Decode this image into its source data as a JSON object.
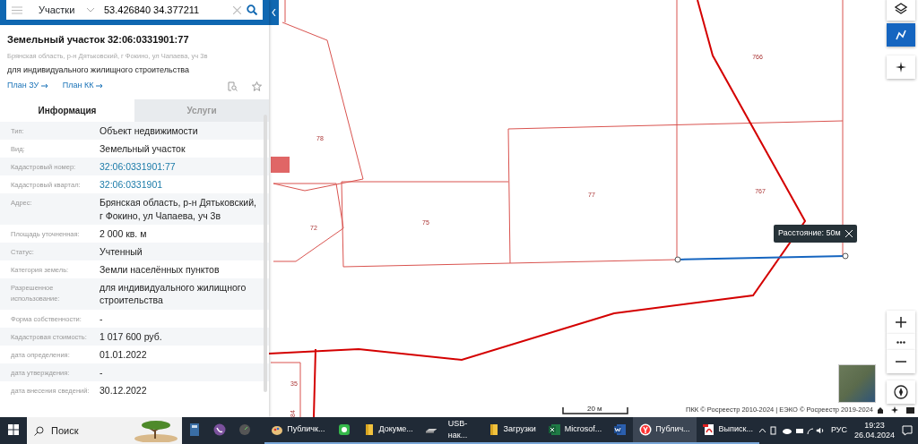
{
  "search": {
    "category": "Участки",
    "query": "53.426840 34.377211"
  },
  "parcel": {
    "title": "Земельный участок 32:06:0331901:77",
    "address": "Брянская область, р-н Дятьковский, г Фокино, ул Чапаева, уч 3в",
    "purpose": "для индивидуального жилищного строительства",
    "links": [
      "План ЗУ",
      "План КК"
    ]
  },
  "tabs": [
    {
      "label": "Информация",
      "selected": true
    },
    {
      "label": "Услуги",
      "selected": false
    }
  ],
  "rows": [
    {
      "label": "Тип:",
      "value": "Объект недвижимости",
      "kind": "text"
    },
    {
      "label": "Вид:",
      "value": "Земельный участок",
      "kind": "text"
    },
    {
      "label": "Кадастровый номер:",
      "value": "32:06:0331901:77",
      "kind": "link"
    },
    {
      "label": "Кадастровый квартал:",
      "value": "32:06:0331901",
      "kind": "link"
    },
    {
      "label": "Адрес:",
      "value": "Брянская область, р-н Дятьковский, г Фокино, ул Чапаева, уч 3в",
      "kind": "text"
    },
    {
      "label": "Площадь уточненная:",
      "value": "2 000 кв. м",
      "kind": "text"
    },
    {
      "label": "Статус:",
      "value": "Учтенный",
      "kind": "text"
    },
    {
      "label": "Категория земель:",
      "value": "Земли населённых пунктов",
      "kind": "text"
    },
    {
      "label": "Разрешенное использование:",
      "value": "для индивидуального жилищного строительства",
      "kind": "text"
    },
    {
      "label": "Форма собственности:",
      "value": "-",
      "kind": "text"
    },
    {
      "label": "Кадастровая стоимость:",
      "value": "1 017 600 руб.",
      "kind": "text"
    },
    {
      "label": "дата определения:",
      "value": "01.01.2022",
      "kind": "text"
    },
    {
      "label": "дата утверждения:",
      "value": "-",
      "kind": "text"
    },
    {
      "label": "дата внесения сведений:",
      "value": "30.12.2022",
      "kind": "text"
    }
  ],
  "map": {
    "parcel_labels": [
      "766",
      "78",
      "77",
      "767",
      "75",
      "72",
      "35",
      "84"
    ],
    "measure": "Расстояние: 50м",
    "scale": "20 м",
    "attribution": "ПКК © Росреестр 2010-2024 | ЕЭКО © Росреестр 2019-2024"
  },
  "taskbar": {
    "search_placeholder": "Поиск",
    "apps": [
      {
        "kind": "calculator",
        "running": false,
        "selected": false
      },
      {
        "kind": "viber",
        "running": false,
        "selected": false
      },
      {
        "kind": "gauge",
        "running": false,
        "selected": false
      },
      {
        "kind": "paint",
        "label": "Публичк...",
        "running": true,
        "selected": false
      },
      {
        "kind": "green",
        "running": true,
        "selected": false
      },
      {
        "kind": "folder",
        "label": "Докуме...",
        "running": true,
        "selected": false
      },
      {
        "kind": "drive",
        "label": "USB-нак...",
        "running": true,
        "selected": false
      },
      {
        "kind": "folder",
        "label": "Загрузки",
        "running": true,
        "selected": false
      },
      {
        "kind": "excel",
        "label": "Microsof...",
        "running": true,
        "selected": false
      },
      {
        "kind": "word",
        "running": true,
        "selected": false
      },
      {
        "kind": "yandex",
        "label": "Публич...",
        "running": true,
        "selected": true
      },
      {
        "kind": "pdf",
        "label": "Выписк...",
        "running": true,
        "selected": false
      }
    ],
    "language": "РУС",
    "time": "19:23",
    "date": "26.04.2024"
  }
}
